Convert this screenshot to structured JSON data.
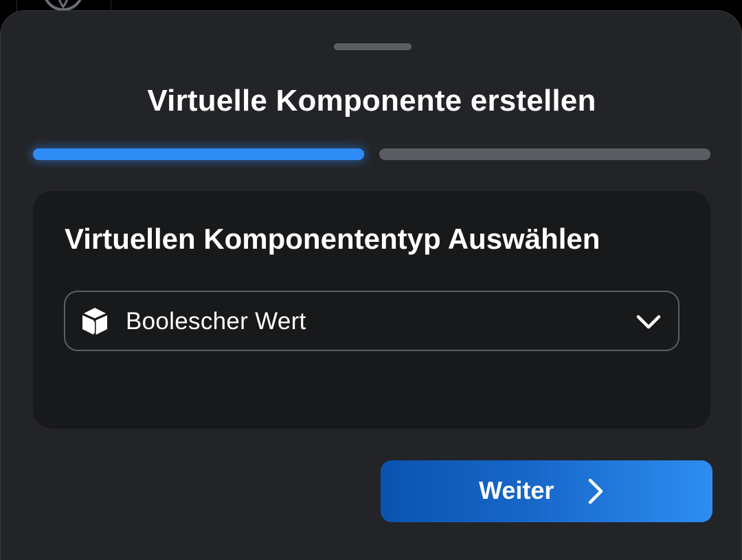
{
  "dialog": {
    "title": "Virtuelle Komponente erstellen"
  },
  "progress": {
    "total_steps": 2,
    "current_step": 1
  },
  "card": {
    "heading": "Virtuellen Komponententyp Auswählen"
  },
  "component_type_select": {
    "selected_value": "Boolescher Wert",
    "icon": "cube-icon"
  },
  "actions": {
    "next_label": "Weiter"
  },
  "colors": {
    "accent": "#2f8cf5",
    "sheet_background": "#232427",
    "card_background": "#18191b"
  }
}
